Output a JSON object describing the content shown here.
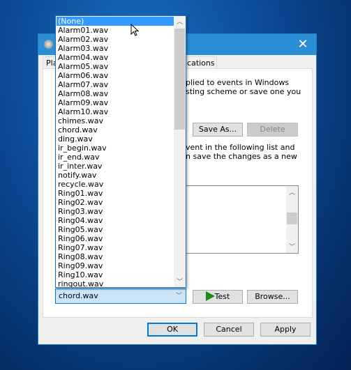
{
  "dialog": {
    "close_icon": "close-icon",
    "tabs": [
      "Pla",
      "nications"
    ]
  },
  "panel": {
    "intro_lines": [
      "plied to events in Windows",
      "sting scheme or save one you"
    ],
    "save_as": "Save As...",
    "delete": "Delete",
    "events_lines": [
      "vent in the following list and",
      "n save the changes as a new"
    ]
  },
  "sound_combo": {
    "value": "chord.wav",
    "test": "Test",
    "browse": "Browse..."
  },
  "dropdown": {
    "selected": "(None)",
    "items": [
      "(None)",
      "Alarm01.wav",
      "Alarm02.wav",
      "Alarm03.wav",
      "Alarm04.wav",
      "Alarm05.wav",
      "Alarm06.wav",
      "Alarm07.wav",
      "Alarm08.wav",
      "Alarm09.wav",
      "Alarm10.wav",
      "chimes.wav",
      "chord.wav",
      "ding.wav",
      "ir_begin.wav",
      "ir_end.wav",
      "ir_inter.wav",
      "notify.wav",
      "recycle.wav",
      "Ring01.wav",
      "Ring02.wav",
      "Ring03.wav",
      "Ring04.wav",
      "Ring05.wav",
      "Ring06.wav",
      "Ring07.wav",
      "Ring08.wav",
      "Ring09.wav",
      "Ring10.wav",
      "ringout.wav"
    ]
  },
  "footer": {
    "ok": "OK",
    "cancel": "Cancel",
    "apply": "Apply"
  },
  "colors": {
    "titlebar": "#2b8fd8",
    "selection": "#3399ff",
    "test_icon": "#1e8a1e"
  }
}
